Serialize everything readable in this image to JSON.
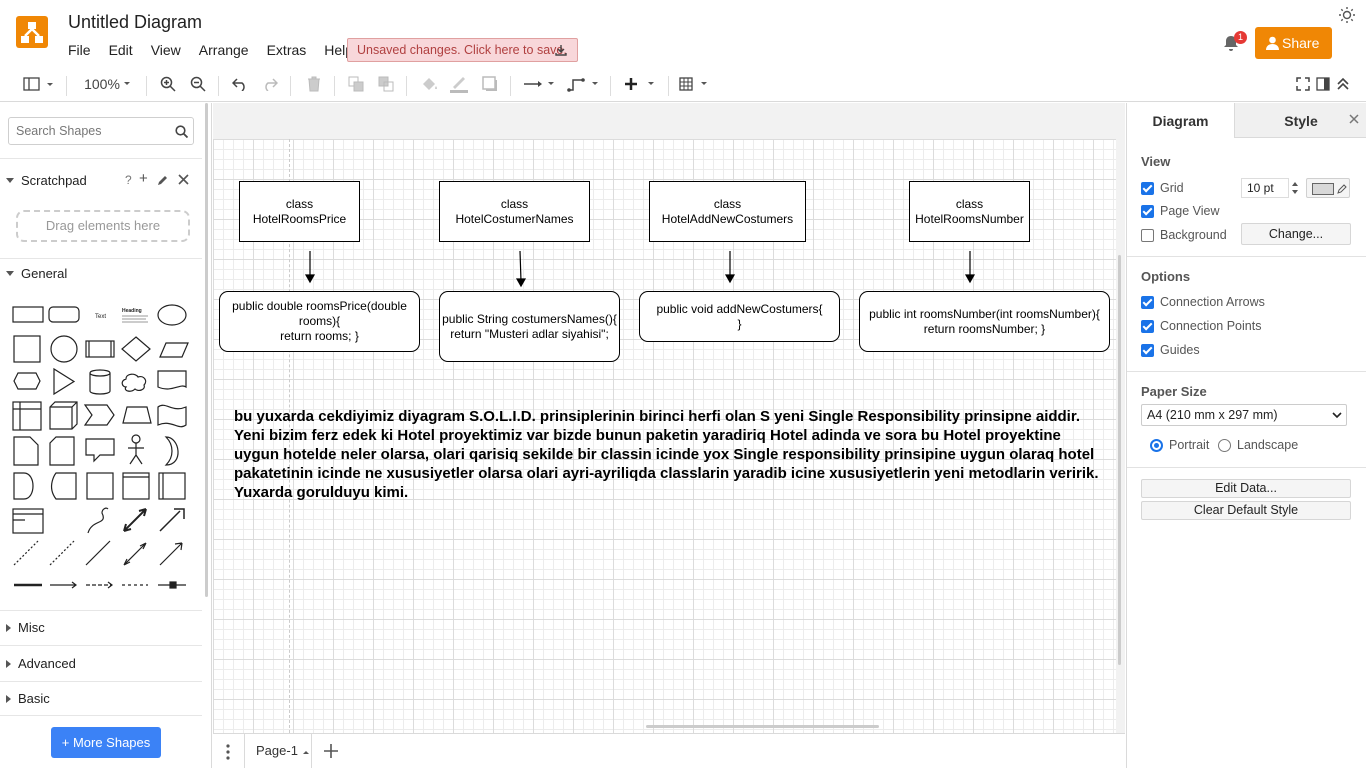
{
  "app": {
    "title": "Untitled Diagram",
    "brand_color": "#f08705",
    "menus": [
      "File",
      "Edit",
      "View",
      "Arrange",
      "Extras",
      "Help"
    ],
    "unsaved_label": "Unsaved changes. Click here to save.",
    "share_label": "Share",
    "notification_count": "1"
  },
  "toolbar": {
    "zoom": "100%",
    "icons": [
      "sidebar-toggle-icon",
      "zoom-in-icon",
      "zoom-out-icon",
      "undo-icon",
      "redo-icon",
      "delete-icon",
      "to-front-icon",
      "to-back-icon",
      "fill-color-icon",
      "line-color-icon",
      "shadow-icon",
      "connection-icon",
      "waypoints-icon",
      "insert-icon",
      "table-icon",
      "fullscreen-icon",
      "format-panel-icon",
      "collapse-icon"
    ]
  },
  "sidebar": {
    "search_placeholder": "Search Shapes",
    "scratchpad": "Scratchpad",
    "scratchpad_actions": [
      "?",
      "+"
    ],
    "drag_hint": "Drag elements here",
    "general": "General",
    "sections": [
      "Misc",
      "Advanced",
      "Basic"
    ],
    "more_shapes": "+ More Shapes",
    "shape_text_label": "Text",
    "shape_heading_label": "Heading"
  },
  "diagram": {
    "classes": [
      {
        "label": "class\nHotelRoomsPrice"
      },
      {
        "label": "class\nHotelCostumerNames"
      },
      {
        "label": "class\nHotelAddNewCostumers"
      },
      {
        "label": "class\nHotelRoomsNumber"
      }
    ],
    "methods": [
      {
        "label": "public double roomsPrice(double rooms){\nreturn rooms; }"
      },
      {
        "label": "public String costumersNames(){\nreturn \"Musteri adlar siyahisi\";"
      },
      {
        "label": "public void addNewCostumers{\n}"
      },
      {
        "label": "public int roomsNumber(int roomsNumber){\nreturn roomsNumber; }"
      }
    ],
    "note": "bu yuxarda cekdiyimiz diyagram S.O.L.I.D. prinsiplerinin birinci herfi olan S yeni Single Responsibility prinsipne aiddir. Yeni bizim ferz edek ki Hotel proyektimiz var bizde bunun paketin yaradiriq Hotel adinda ve sora bu Hotel proyektine uygun hotelde neler olarsa, olari qarisiq sekilde bir classin icinde yox Single responsibility prinsipine uygun olaraq hotel pakatetinin icinde ne xususiyetler olarsa olari ayri-ayriliqda classlarin yaradib icine xususiyetlerin yeni metodlarin veririk. Yuxarda gorulduyu kimi."
  },
  "pages": {
    "current": "Page-1"
  },
  "format_panel": {
    "tabs": [
      "Diagram",
      "Style"
    ],
    "view_title": "View",
    "grid": "Grid",
    "grid_size": "10 pt",
    "page_view": "Page View",
    "background": "Background",
    "change_btn": "Change...",
    "options_title": "Options",
    "connection_arrows": "Connection Arrows",
    "connection_points": "Connection Points",
    "guides": "Guides",
    "paper_title": "Paper Size",
    "paper_size": "A4 (210 mm x 297 mm)",
    "portrait": "Portrait",
    "landscape": "Landscape",
    "edit_data": "Edit Data...",
    "clear_style": "Clear Default Style"
  }
}
